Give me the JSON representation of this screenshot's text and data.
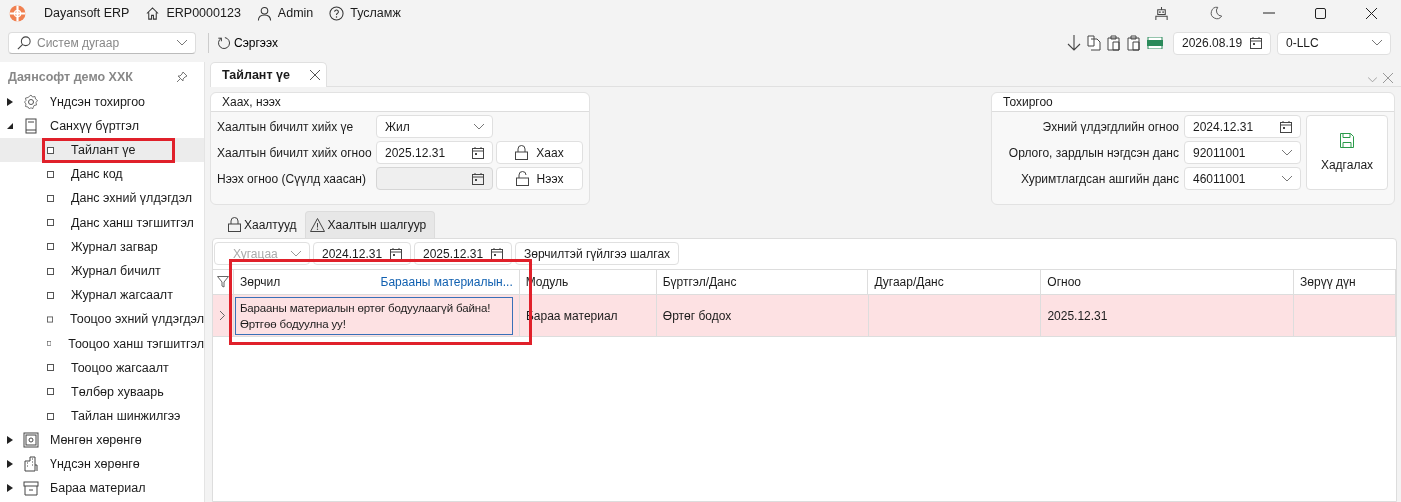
{
  "titlebar": {
    "app": "Dayansoft ERP",
    "company": "ERP0000123",
    "user": "Admin",
    "help": "Тусламж"
  },
  "toolbar": {
    "search_placeholder": "Систем дугаар",
    "refresh": "Сэргээх",
    "date": "2026.08.19",
    "company_select": "0-LLC"
  },
  "sidebar": {
    "title": "Даянсофт демо ХХК",
    "items": [
      {
        "label": "Үндсэн тохиргоо",
        "kind": "settings",
        "expanded": false
      },
      {
        "label": "Санхүү бүртгэл",
        "kind": "finance",
        "expanded": true,
        "children": [
          {
            "label": "Тайлант үе",
            "selected": true,
            "highlighted": true
          },
          {
            "label": "Данс код",
            "selected": false,
            "highlighted": false
          },
          {
            "label": "Данс эхний үлдэгдэл",
            "selected": false,
            "highlighted": false
          },
          {
            "label": "Данс ханш тэгшитгэл",
            "selected": false,
            "highlighted": false
          },
          {
            "label": "Журнал загвар",
            "selected": false,
            "highlighted": false
          },
          {
            "label": "Журнал бичилт",
            "selected": false,
            "highlighted": false
          },
          {
            "label": "Журнал жагсаалт",
            "selected": false,
            "highlighted": false
          },
          {
            "label": "Тооцоо эхний үлдэгдэл",
            "selected": false,
            "highlighted": false
          },
          {
            "label": "Тооцоо ханш тэгшитгэл",
            "selected": false,
            "highlighted": false
          },
          {
            "label": "Тооцоо жагсаалт",
            "selected": false,
            "highlighted": false
          },
          {
            "label": "Төлбөр хуваарь",
            "selected": false,
            "highlighted": false
          },
          {
            "label": "Тайлан шинжилгээ",
            "selected": false,
            "highlighted": false
          }
        ]
      },
      {
        "label": "Мөнгөн хөрөнгө",
        "kind": "cash",
        "expanded": false
      },
      {
        "label": "Үндсэн хөрөнгө",
        "kind": "assets",
        "expanded": false
      },
      {
        "label": "Бараа материал",
        "kind": "inventory",
        "expanded": false
      }
    ]
  },
  "tabs": [
    {
      "label": "Тайлант үе",
      "selected": true
    }
  ],
  "close_open": {
    "title": "Хаах, нээх",
    "rows": [
      {
        "label": "Хаалтын бичилт хийх үе",
        "kind": "select",
        "value": "Жил",
        "disabled": false
      },
      {
        "label": "Хаалтын бичилт хийх огноо",
        "kind": "date",
        "value": "2025.12.31",
        "disabled": false,
        "button": "Хаах",
        "locked": true
      },
      {
        "label": "Нээх огноо (Сүүлд хаасан)",
        "kind": "date",
        "disabled": true,
        "button": "Нээх",
        "locked": false
      }
    ]
  },
  "settings": {
    "title": "Тохиргоо",
    "rows": [
      {
        "label": "Эхний үлдэгдлийн огноо",
        "kind": "date",
        "value": "2024.12.31"
      },
      {
        "label": "Орлого, зардлын нэгдсэн данс",
        "kind": "select",
        "value": "92011001"
      },
      {
        "label": "Хуримтлагдсан ашгийн данс",
        "kind": "select",
        "value": "46011001"
      }
    ],
    "save": "Хадгалах"
  },
  "subtabs": [
    {
      "label": "Хаалтууд",
      "kind": "closings",
      "selected": false
    },
    {
      "label": "Хаалтын шалгуур",
      "kind": "checks",
      "selected": true
    }
  ],
  "filter": {
    "period_placeholder": "Хугацаа",
    "from": "2024.12.31",
    "to": "2025.12.31",
    "button": "Зөрчилтэй гүйлгээ шалгах"
  },
  "grid": {
    "columns": [
      {
        "label": "Зөрчил",
        "link": "Барааны материалын..."
      },
      {
        "label": "Модуль"
      },
      {
        "label": "Бүртгэл/Данс"
      },
      {
        "label": "Дугаар/Данс"
      },
      {
        "label": "Огноо"
      },
      {
        "label": "Зөрүү дүн"
      }
    ],
    "rows": [
      {
        "error": true,
        "highlighted": true,
        "cells": [
          "Барааны материалын өртөг бодуулаагүй байна! Өртгөө бодуулна уу!",
          "Бараа материал",
          "Өртөг бодох",
          "",
          "2025.12.31",
          ""
        ]
      }
    ]
  }
}
